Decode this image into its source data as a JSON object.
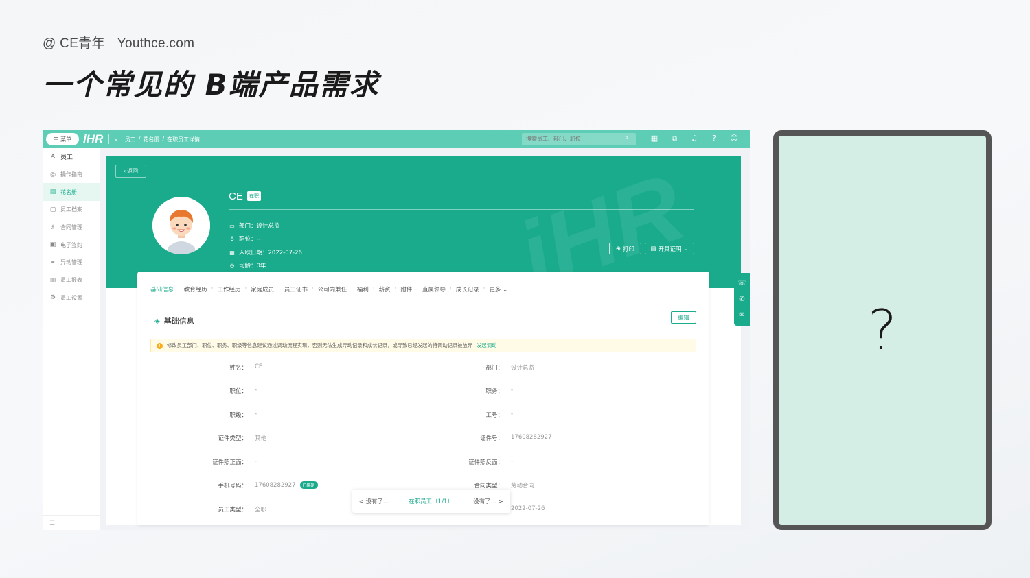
{
  "header": {
    "brand": "@ CE青年",
    "site": "Youthce.com",
    "title": "一个常见的 B端产品需求"
  },
  "app": {
    "menu_label": "菜单",
    "logo": "iHR",
    "breadcrumb": [
      "员工",
      "/",
      "花名册",
      "/",
      "在职员工详情"
    ],
    "search_placeholder": "搜索员工、部门、职位",
    "top_icons": [
      "qrcode-icon",
      "org-icon",
      "bell-icon",
      "help-icon",
      "user-icon"
    ]
  },
  "sidebar": {
    "items": [
      {
        "label": "员工",
        "icon": "user-icon"
      },
      {
        "label": "操作指南",
        "icon": "guide-icon"
      },
      {
        "label": "花名册",
        "icon": "roster-icon"
      },
      {
        "label": "员工档案",
        "icon": "archive-icon"
      },
      {
        "label": "合同管理",
        "icon": "contract-icon"
      },
      {
        "label": "电子签约",
        "icon": "esign-icon"
      },
      {
        "label": "异动管理",
        "icon": "transfer-icon"
      },
      {
        "label": "员工报表",
        "icon": "report-icon"
      },
      {
        "label": "员工设置",
        "icon": "settings-icon"
      }
    ],
    "active_index": 2
  },
  "profile": {
    "back_label": "返回",
    "name": "CE",
    "status": "在职",
    "department": "部门：设计总监",
    "position": "职位：--",
    "hire_date": "入职日期：2022-07-26",
    "tenure": "司龄：0年",
    "print_label": "打印",
    "certificate_label": "开具证明"
  },
  "tabs": [
    "基础信息",
    "教育经历",
    "工作经历",
    "家庭成员",
    "员工证书",
    "公司内兼任",
    "福利",
    "薪资",
    "附件",
    "直属领导",
    "成长记录",
    "更多"
  ],
  "section": {
    "title": "基础信息",
    "edit_label": "编辑",
    "notice": "修改员工部门、职位、职务、职级等信息建议通过调动流程实现，否则无法生成异动记录和成长记录，或导致已经发起的待调动记录被放弃",
    "notice_link": "发起调动"
  },
  "fields": {
    "left": [
      {
        "label": "姓名：",
        "value": "CE"
      },
      {
        "label": "职位：",
        "value": "-"
      },
      {
        "label": "职级：",
        "value": "-"
      },
      {
        "label": "证件类型：",
        "value": "其他"
      },
      {
        "label": "证件照正面：",
        "value": "-"
      },
      {
        "label": "手机号码：",
        "value": "17608282927",
        "badge": "已绑定"
      },
      {
        "label": "员工类型：",
        "value": "全职"
      }
    ],
    "right": [
      {
        "label": "部门：",
        "value": "设计总监"
      },
      {
        "label": "职务：",
        "value": "-"
      },
      {
        "label": "工号：",
        "value": "-"
      },
      {
        "label": "证件号：",
        "value": "17608282927"
      },
      {
        "label": "证件照反面：",
        "value": "-"
      },
      {
        "label": "合同类型：",
        "value": "劳动合同"
      },
      {
        "label": "",
        "value": "2022-07-26"
      }
    ]
  },
  "pager": {
    "prev": "< 没有了...",
    "current": "在职员工（1/1）",
    "next": "没有了... >"
  },
  "tablet": {
    "placeholder": "?"
  }
}
